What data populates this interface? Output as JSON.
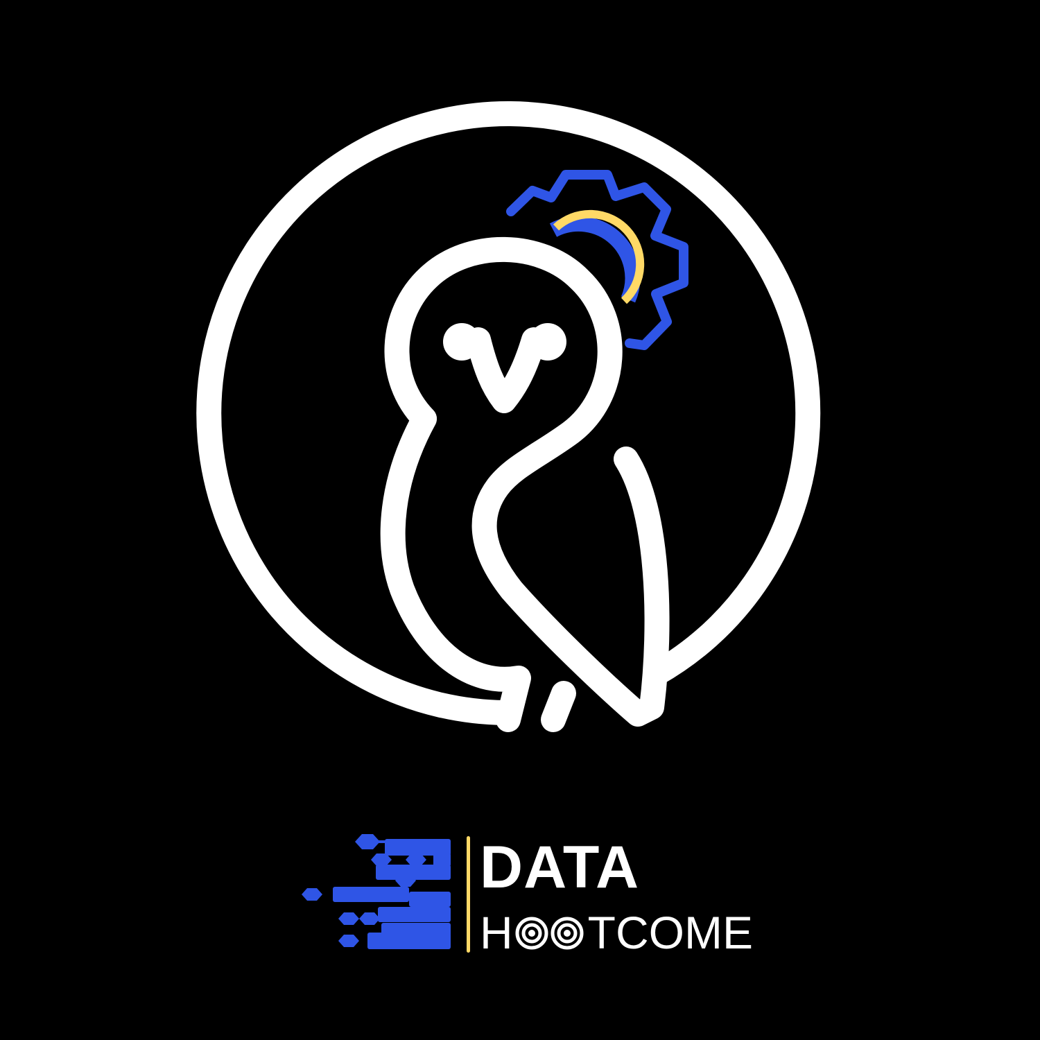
{
  "logo": {
    "brand_line_1": "DATA",
    "brand_line_2_prefix": "H",
    "brand_line_2_eyes": "OO",
    "brand_line_2_suffix": "TCOME"
  },
  "colors": {
    "background": "#000000",
    "outline": "#ffffff",
    "gear": "#2f55e6",
    "accent": "#ffd966",
    "bars": "#2f55e6",
    "divider": "#ffd966"
  },
  "icons": [
    "owl-emblem-icon",
    "gear-icon",
    "data-bars-icon",
    "owl-eyes-icon"
  ]
}
